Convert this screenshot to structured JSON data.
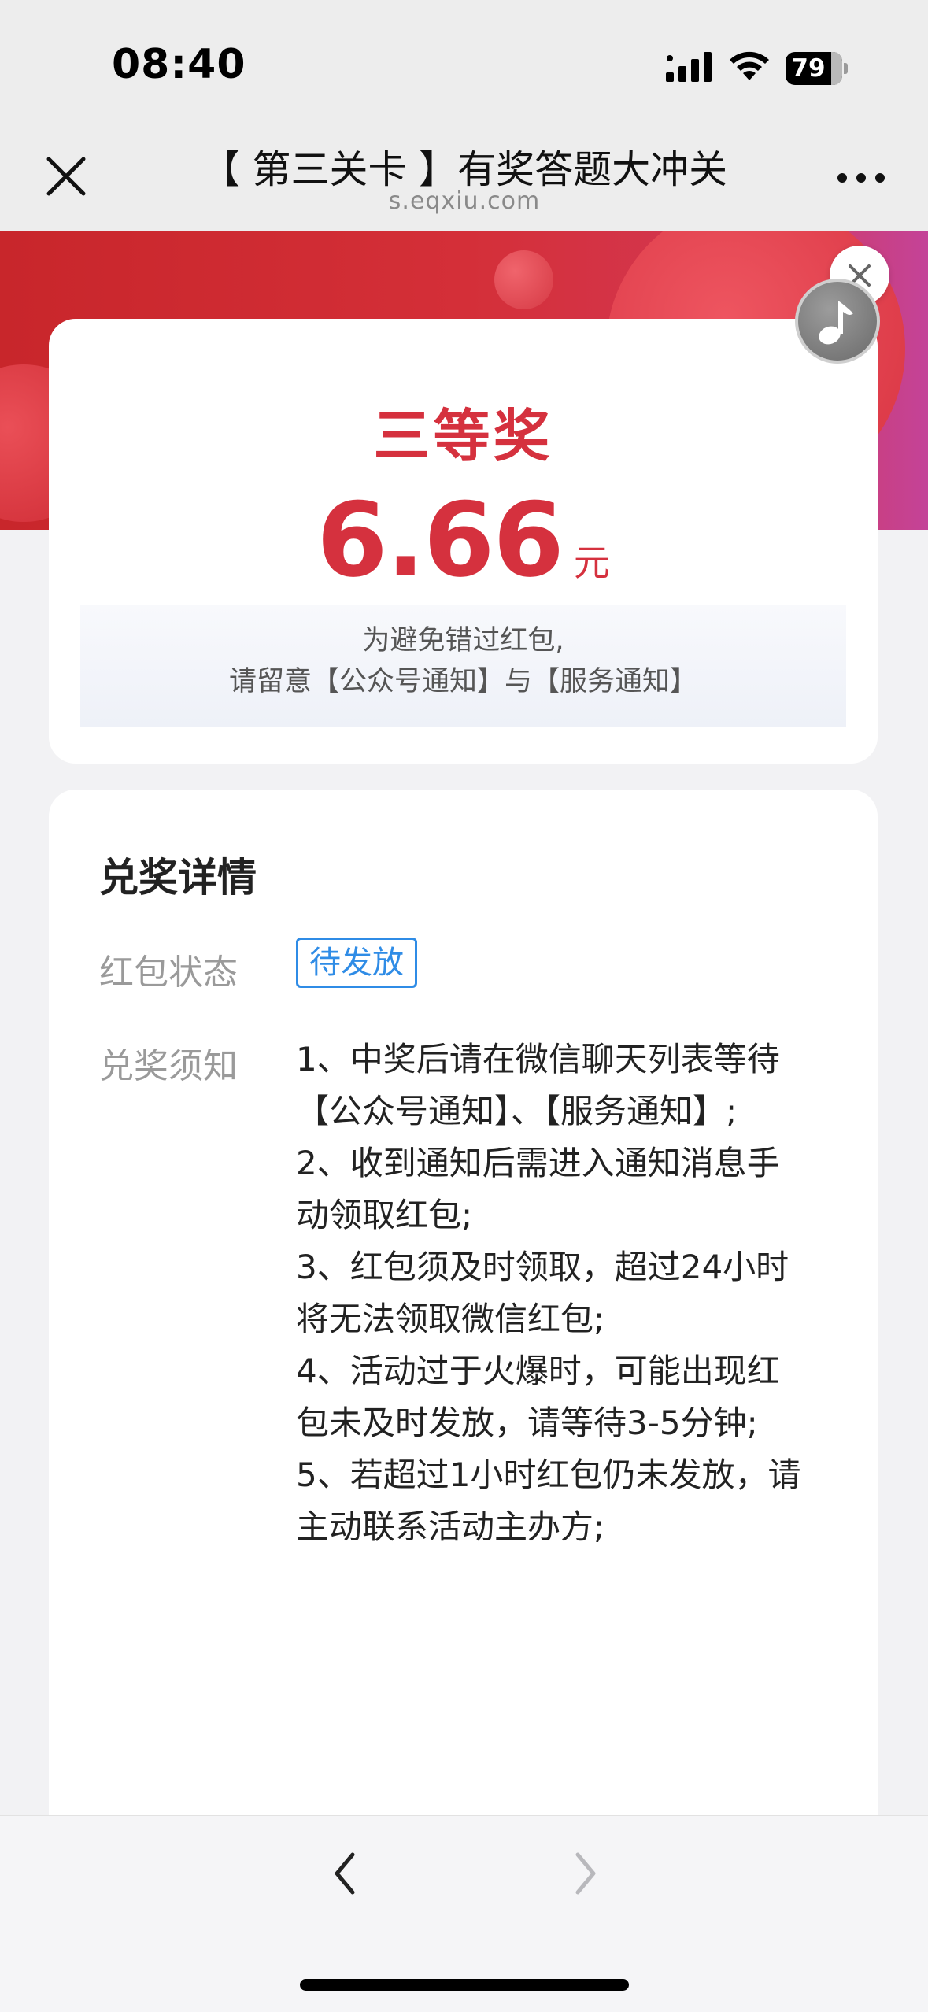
{
  "status_bar": {
    "time": "08:40",
    "battery": "79"
  },
  "nav": {
    "title": "【 第三关卡 】有奖答题大冲关",
    "url": "s.eqxiu.com"
  },
  "prize": {
    "level": "三等奖",
    "amount": "6.66",
    "unit": "元",
    "notice_line1": "为避免错过红包,",
    "notice_line2": "请留意【公众号通知】与【服务通知】"
  },
  "details": {
    "title": "兑奖详情",
    "status_label": "红包状态",
    "status_value": "待发放",
    "rules_label": "兑奖须知",
    "rules": [
      "1、中奖后请在微信聊天列表等待",
      "【公众号通知】、【服务通知】;",
      "2、收到通知后需进入通知消息手",
      "动领取红包;",
      "3、红包须及时领取，超过24小时",
      "将无法领取微信红包;",
      "4、活动过于火爆时，可能出现红",
      "包未及时发放，请等待3-5分钟;",
      "5、若超过1小时红包仍未发放，请",
      "主动联系活动主办方;"
    ]
  },
  "icons": {
    "nav_close": "close-icon",
    "nav_more": "more-icon",
    "music": "music-note-icon",
    "float_close": "close-icon",
    "back": "chevron-left-icon",
    "forward": "chevron-right-icon"
  },
  "colors": {
    "prize_red": "#d5313e",
    "status_blue": "#2f8ce6",
    "banner_red": "#c8262b"
  }
}
